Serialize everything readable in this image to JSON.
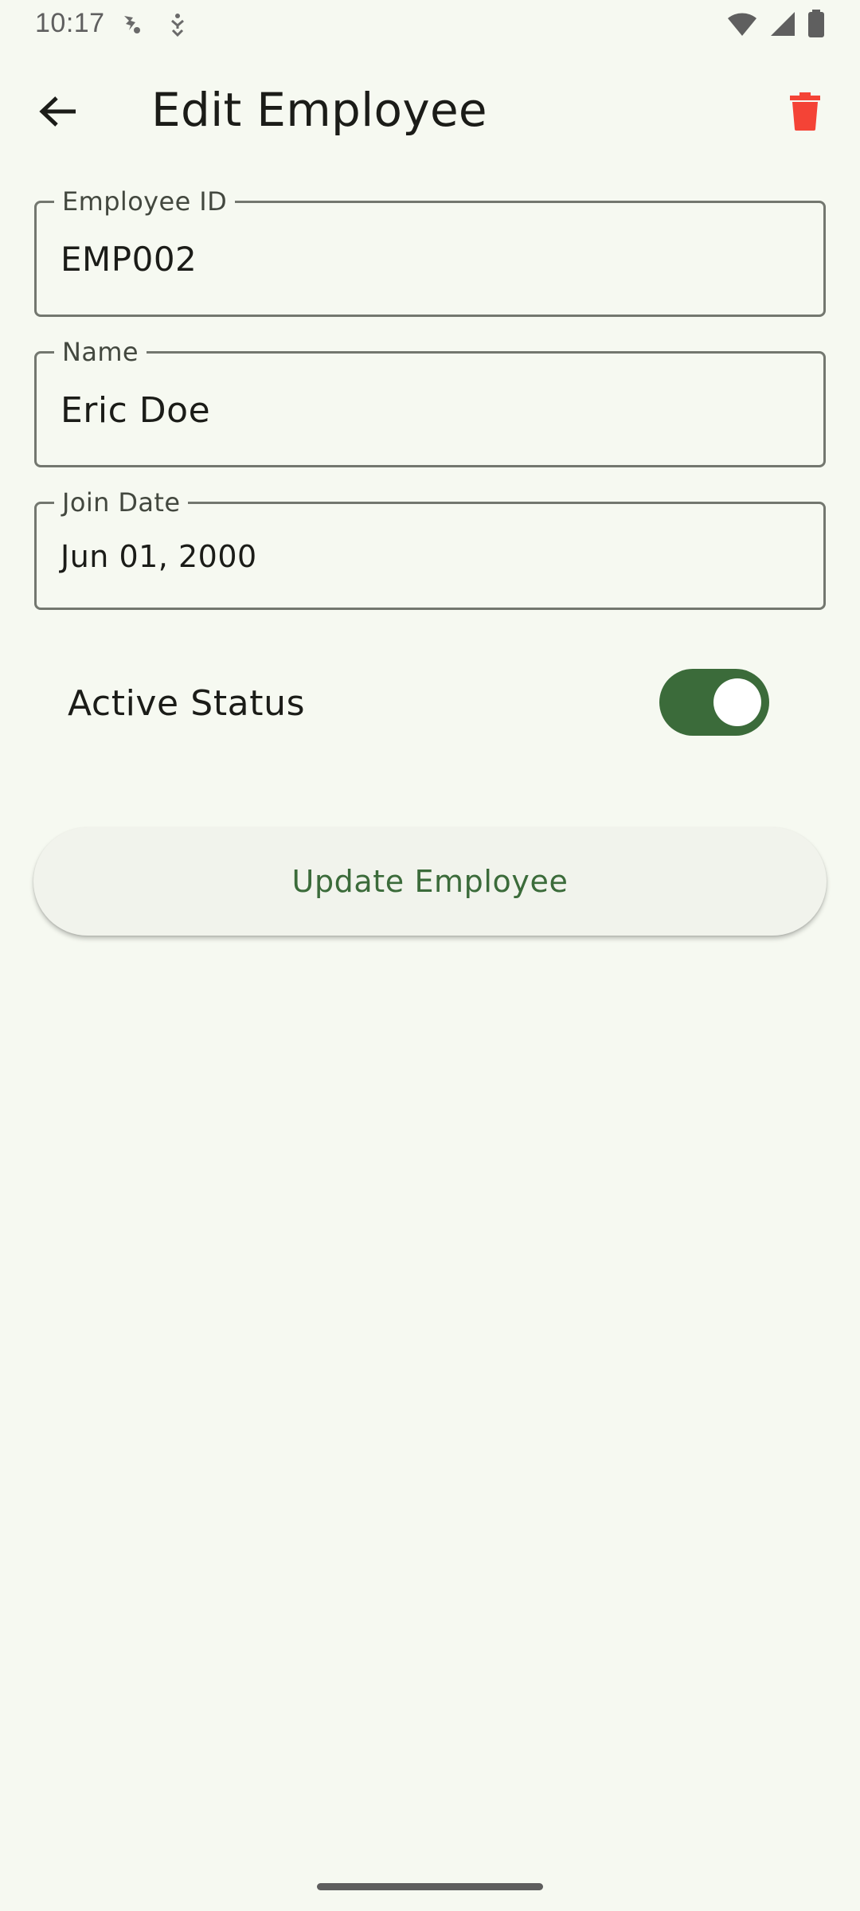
{
  "status_bar": {
    "time": "10:17",
    "left_icons": [
      "notification-icon",
      "accessibility-icon"
    ],
    "right_icons": [
      "wifi-icon",
      "signal-icon",
      "battery-icon"
    ]
  },
  "app_bar": {
    "title": "Edit Employee",
    "back_icon": "arrow-back-icon",
    "delete_icon": "trash-icon",
    "delete_color": "#f44336"
  },
  "form": {
    "employee_id": {
      "label": "Employee ID",
      "value": "EMP002"
    },
    "name": {
      "label": "Name",
      "value": "Eric Doe"
    },
    "join_date": {
      "label": "Join Date",
      "value": "Jun 01, 2000"
    }
  },
  "active_status": {
    "label": "Active Status",
    "enabled": true,
    "accent": "#3b6b3a"
  },
  "actions": {
    "update_label": "Update Employee"
  }
}
